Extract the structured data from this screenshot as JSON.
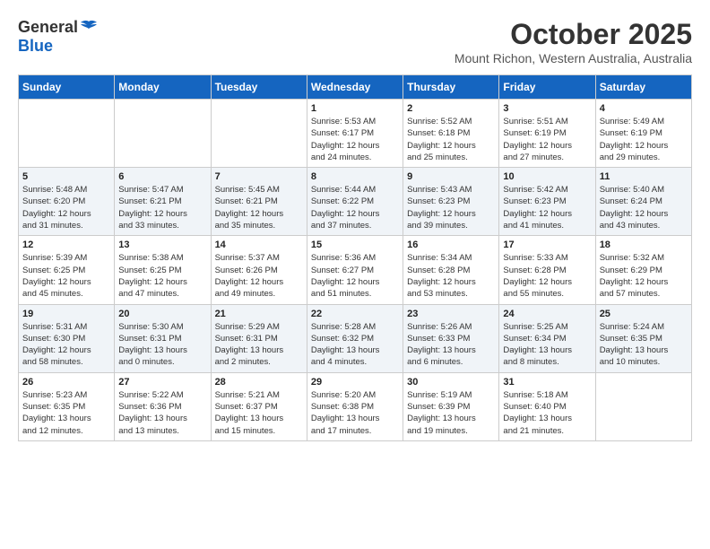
{
  "header": {
    "logo_general": "General",
    "logo_blue": "Blue",
    "month": "October 2025",
    "location": "Mount Richon, Western Australia, Australia"
  },
  "days_of_week": [
    "Sunday",
    "Monday",
    "Tuesday",
    "Wednesday",
    "Thursday",
    "Friday",
    "Saturday"
  ],
  "weeks": [
    [
      {
        "day": "",
        "info": ""
      },
      {
        "day": "",
        "info": ""
      },
      {
        "day": "",
        "info": ""
      },
      {
        "day": "1",
        "info": "Sunrise: 5:53 AM\nSunset: 6:17 PM\nDaylight: 12 hours\nand 24 minutes."
      },
      {
        "day": "2",
        "info": "Sunrise: 5:52 AM\nSunset: 6:18 PM\nDaylight: 12 hours\nand 25 minutes."
      },
      {
        "day": "3",
        "info": "Sunrise: 5:51 AM\nSunset: 6:19 PM\nDaylight: 12 hours\nand 27 minutes."
      },
      {
        "day": "4",
        "info": "Sunrise: 5:49 AM\nSunset: 6:19 PM\nDaylight: 12 hours\nand 29 minutes."
      }
    ],
    [
      {
        "day": "5",
        "info": "Sunrise: 5:48 AM\nSunset: 6:20 PM\nDaylight: 12 hours\nand 31 minutes."
      },
      {
        "day": "6",
        "info": "Sunrise: 5:47 AM\nSunset: 6:21 PM\nDaylight: 12 hours\nand 33 minutes."
      },
      {
        "day": "7",
        "info": "Sunrise: 5:45 AM\nSunset: 6:21 PM\nDaylight: 12 hours\nand 35 minutes."
      },
      {
        "day": "8",
        "info": "Sunrise: 5:44 AM\nSunset: 6:22 PM\nDaylight: 12 hours\nand 37 minutes."
      },
      {
        "day": "9",
        "info": "Sunrise: 5:43 AM\nSunset: 6:23 PM\nDaylight: 12 hours\nand 39 minutes."
      },
      {
        "day": "10",
        "info": "Sunrise: 5:42 AM\nSunset: 6:23 PM\nDaylight: 12 hours\nand 41 minutes."
      },
      {
        "day": "11",
        "info": "Sunrise: 5:40 AM\nSunset: 6:24 PM\nDaylight: 12 hours\nand 43 minutes."
      }
    ],
    [
      {
        "day": "12",
        "info": "Sunrise: 5:39 AM\nSunset: 6:25 PM\nDaylight: 12 hours\nand 45 minutes."
      },
      {
        "day": "13",
        "info": "Sunrise: 5:38 AM\nSunset: 6:25 PM\nDaylight: 12 hours\nand 47 minutes."
      },
      {
        "day": "14",
        "info": "Sunrise: 5:37 AM\nSunset: 6:26 PM\nDaylight: 12 hours\nand 49 minutes."
      },
      {
        "day": "15",
        "info": "Sunrise: 5:36 AM\nSunset: 6:27 PM\nDaylight: 12 hours\nand 51 minutes."
      },
      {
        "day": "16",
        "info": "Sunrise: 5:34 AM\nSunset: 6:28 PM\nDaylight: 12 hours\nand 53 minutes."
      },
      {
        "day": "17",
        "info": "Sunrise: 5:33 AM\nSunset: 6:28 PM\nDaylight: 12 hours\nand 55 minutes."
      },
      {
        "day": "18",
        "info": "Sunrise: 5:32 AM\nSunset: 6:29 PM\nDaylight: 12 hours\nand 57 minutes."
      }
    ],
    [
      {
        "day": "19",
        "info": "Sunrise: 5:31 AM\nSunset: 6:30 PM\nDaylight: 12 hours\nand 58 minutes."
      },
      {
        "day": "20",
        "info": "Sunrise: 5:30 AM\nSunset: 6:31 PM\nDaylight: 13 hours\nand 0 minutes."
      },
      {
        "day": "21",
        "info": "Sunrise: 5:29 AM\nSunset: 6:31 PM\nDaylight: 13 hours\nand 2 minutes."
      },
      {
        "day": "22",
        "info": "Sunrise: 5:28 AM\nSunset: 6:32 PM\nDaylight: 13 hours\nand 4 minutes."
      },
      {
        "day": "23",
        "info": "Sunrise: 5:26 AM\nSunset: 6:33 PM\nDaylight: 13 hours\nand 6 minutes."
      },
      {
        "day": "24",
        "info": "Sunrise: 5:25 AM\nSunset: 6:34 PM\nDaylight: 13 hours\nand 8 minutes."
      },
      {
        "day": "25",
        "info": "Sunrise: 5:24 AM\nSunset: 6:35 PM\nDaylight: 13 hours\nand 10 minutes."
      }
    ],
    [
      {
        "day": "26",
        "info": "Sunrise: 5:23 AM\nSunset: 6:35 PM\nDaylight: 13 hours\nand 12 minutes."
      },
      {
        "day": "27",
        "info": "Sunrise: 5:22 AM\nSunset: 6:36 PM\nDaylight: 13 hours\nand 13 minutes."
      },
      {
        "day": "28",
        "info": "Sunrise: 5:21 AM\nSunset: 6:37 PM\nDaylight: 13 hours\nand 15 minutes."
      },
      {
        "day": "29",
        "info": "Sunrise: 5:20 AM\nSunset: 6:38 PM\nDaylight: 13 hours\nand 17 minutes."
      },
      {
        "day": "30",
        "info": "Sunrise: 5:19 AM\nSunset: 6:39 PM\nDaylight: 13 hours\nand 19 minutes."
      },
      {
        "day": "31",
        "info": "Sunrise: 5:18 AM\nSunset: 6:40 PM\nDaylight: 13 hours\nand 21 minutes."
      },
      {
        "day": "",
        "info": ""
      }
    ]
  ]
}
